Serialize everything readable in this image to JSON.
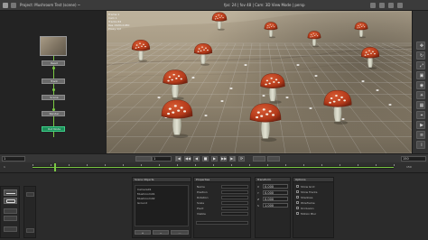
{
  "window": {
    "title": "Project: Mushroom Test (scene) ~"
  },
  "colors": {
    "accent_green": "#7ac943",
    "node_select_green": "#1f8f5b",
    "mushroom_cap_red": "#b33a1a",
    "mushroom_stem": "#d6d6c6"
  },
  "topbar": {
    "icons": [
      "app-logo-icon",
      "menu-icon"
    ],
    "viewer_caption": "fps: 24 | fov 48 | Cam: 3D View Mode | persp",
    "right_icons": [
      "camera-icon",
      "lock-icon",
      "grid-icon",
      "settings-icon"
    ]
  },
  "nodegraph": {
    "nodes": [
      {
        "id": "read",
        "label": "Read"
      },
      {
        "id": "track",
        "label": "Track"
      },
      {
        "id": "scene",
        "label": "Scene"
      },
      {
        "id": "render",
        "label": "Render"
      },
      {
        "id": "out",
        "label": "Out Node"
      }
    ]
  },
  "viewer": {
    "hud_lines": [
      "Frame 1",
      "Cam 1",
      "Tracks 64",
      "Res 1920x1080",
      "Proxy 1/2"
    ],
    "mushroom_count": 14
  },
  "right_toolbar": {
    "buttons": [
      {
        "name": "move-tool-button",
        "glyph": "✥"
      },
      {
        "name": "rotate-tool-button",
        "glyph": "↻"
      },
      {
        "name": "scale-tool-button",
        "glyph": "⤢"
      },
      {
        "name": "select-tool-button",
        "glyph": "▣"
      },
      {
        "name": "camera-tool-button",
        "glyph": "◉"
      },
      {
        "name": "light-tool-button",
        "glyph": "☀"
      },
      {
        "name": "grid-tool-button",
        "glyph": "▦"
      },
      {
        "name": "snap-tool-button",
        "glyph": "⌖"
      },
      {
        "name": "render-tool-button",
        "glyph": "▶"
      },
      {
        "name": "layers-tool-button",
        "glyph": "≡"
      },
      {
        "name": "info-tool-button",
        "glyph": "i"
      }
    ]
  },
  "transport": {
    "start_frame": "1",
    "current_frame": "1",
    "end_frame": "150",
    "buttons": [
      "|◀",
      "◀◀",
      "◀",
      "■",
      "▶",
      "▶▶",
      "▶|",
      "⟳"
    ]
  },
  "timeline": {
    "start_label": "1",
    "end_label": "150",
    "playhead_fraction": 0.0
  },
  "bottom": {
    "left_panel": {
      "buttons": [
        "Move",
        "Rotate",
        "Scale",
        "Align",
        "Snap",
        "Reset"
      ]
    },
    "object_list": {
      "title": "Scene Objects",
      "items": [
        "Camera01",
        "Mushroom01",
        "Mushroom02",
        "Ground"
      ]
    },
    "properties": {
      "title": "Properties",
      "rows": [
        "Name",
        "Position",
        "Rotation",
        "Scale",
        "Pivot",
        "Visible"
      ]
    },
    "transform": {
      "title": "Transform",
      "fields": [
        {
          "label": "X",
          "value": "0.000"
        },
        {
          "label": "Y",
          "value": "0.000"
        },
        {
          "label": "Z",
          "value": "0.000"
        },
        {
          "label": "S",
          "value": "1.000"
        }
      ]
    },
    "options": {
      "title": "Options",
      "checks": [
        "Show Grid",
        "Show Tracks",
        "Shadows",
        "Wireframe",
        "Occlusion",
        "Motion Blur"
      ]
    }
  }
}
